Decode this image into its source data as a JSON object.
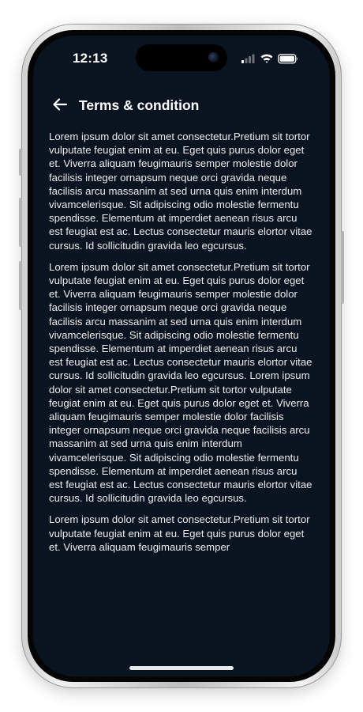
{
  "status_bar": {
    "time": "12:13",
    "icons": [
      "cellular-signal-icon",
      "wifi-icon",
      "battery-icon"
    ]
  },
  "header": {
    "back_icon": "arrow-left-icon",
    "title": "Terms & condition"
  },
  "content": {
    "paragraphs": [
      "Lorem ipsum dolor sit amet consectetur.Pretium sit tortor vulputate feugiat enim at eu. Eget quis purus dolor eget et. Viverra aliquam feugimauris semper molestie dolor facilisis integer ornapsum neque orci gravida neque facilisis arcu massanim at sed urna quis enim interdum vivamcelerisque. Sit adipiscing odio molestie fermentu spendisse. Elementum at imperdiet aenean risus arcu est feugiat est ac. Lectus consectetur mauris elortor vitae cursus. Id sollicitudin gravida leo egcursus.",
      "Lorem ipsum dolor sit amet consectetur.Pretium sit tortor vulputate feugiat enim at eu. Eget quis purus dolor eget et. Viverra aliquam feugimauris semper molestie dolor facilisis integer ornapsum neque orci gravida neque facilisis arcu massanim at sed urna quis enim interdum vivamcelerisque. Sit adipiscing odio molestie fermentu spendisse. Elementum at imperdiet aenean risus arcu est feugiat est ac. Lectus consectetur mauris elortor vitae cursus. Id sollicitudin gravida leo egcursus. Lorem ipsum dolor sit amet consectetur.Pretium sit tortor vulputate feugiat enim at eu. Eget quis purus dolor eget et. Viverra aliquam feugimauris semper molestie dolor facilisis integer ornapsum neque orci gravida neque facilisis arcu massanim at sed urna quis enim interdum vivamcelerisque. Sit adipiscing odio molestie fermentu spendisse. Elementum at imperdiet aenean risus arcu est feugiat est ac. Lectus consectetur mauris elortor vitae cursus. Id sollicitudin gravida leo egcursus.",
      "Lorem ipsum dolor sit amet consectetur.Pretium sit tortor vulputate feugiat enim at eu. Eget quis purus dolor eget et. Viverra aliquam feugimauris semper"
    ]
  },
  "colors": {
    "screen_background": "#0a1421",
    "text": "#ececec",
    "title": "#ffffff"
  }
}
